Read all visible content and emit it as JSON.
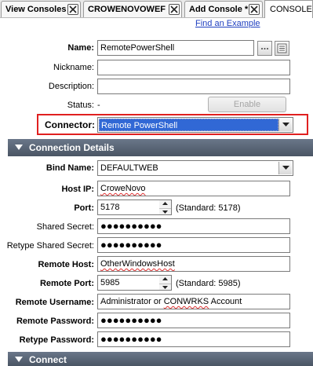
{
  "tabs": [
    {
      "label": "View Consoles"
    },
    {
      "label": "CROWENOVOWEF"
    },
    {
      "label": "Add Console *"
    }
  ],
  "active_tab": {
    "label": "CONSOLES"
  },
  "find_example_link": "Find an Example",
  "general": {
    "name_label": "Name:",
    "name_value": "RemotePowerShell",
    "nickname_label": "Nickname:",
    "nickname_value": "",
    "description_label": "Description:",
    "description_value": "",
    "status_label": "Status:",
    "status_value": "-",
    "enable_button": "Enable",
    "connector_label": "Connector:",
    "connector_value": "Remote PowerShell"
  },
  "connection_details": {
    "header": "Connection Details",
    "bind_name_label": "Bind Name:",
    "bind_name_value": "DEFAULTWEB",
    "host_ip_label": "Host IP:",
    "host_ip_value": "CroweNovo",
    "port_label": "Port:",
    "port_value": "5178",
    "port_standard": "(Standard: 5178)",
    "shared_secret_label": "Shared Secret:",
    "shared_secret_value": "●●●●●●●●●●",
    "retype_shared_secret_label": "Retype Shared Secret:",
    "retype_shared_secret_value": "●●●●●●●●●●",
    "remote_host_label": "Remote Host:",
    "remote_host_value": "OtherWindowsHost",
    "remote_port_label": "Remote Port:",
    "remote_port_value": "5985",
    "remote_port_standard": "(Standard: 5985)",
    "remote_username_label": "Remote Username:",
    "remote_username_value_prefix": "Administrator or ",
    "remote_username_value_word": "CONWRKS",
    "remote_username_value_suffix": " Account",
    "remote_password_label": "Remote Password:",
    "remote_password_value": "●●●●●●●●●●",
    "retype_password_label": "Retype Password:",
    "retype_password_value": "●●●●●●●●●●"
  },
  "connect_section": {
    "header": "Connect"
  },
  "colors": {
    "section_header": "#5a6677",
    "selection": "#3168d5",
    "highlight_border": "#e02020",
    "link": "#2040c0"
  }
}
